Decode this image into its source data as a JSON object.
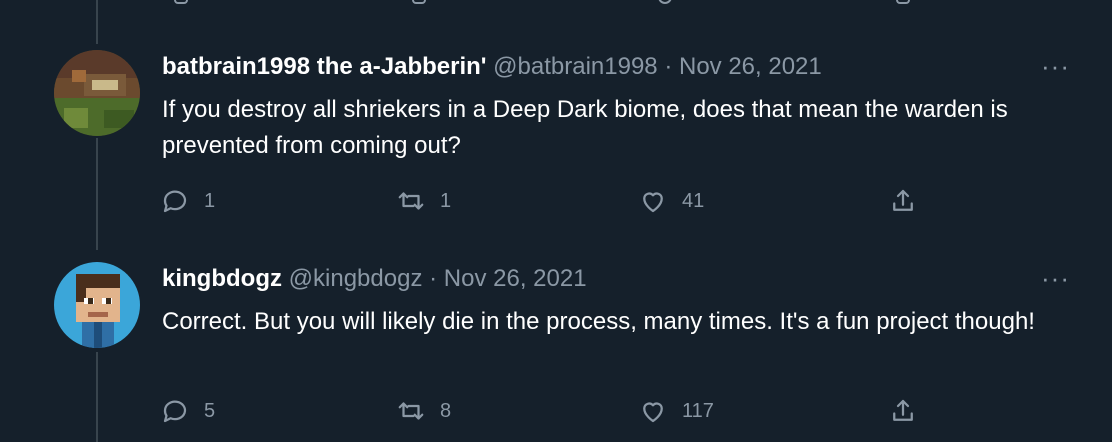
{
  "tweets": [
    {
      "display_name": "batbrain1998 the a-Jabberin'",
      "handle": "@batbrain1998",
      "separator": "·",
      "date": "Nov 26, 2021",
      "text": "If you destroy all shriekers in a Deep Dark biome, does that mean the warden is prevented from coming out?",
      "replies": "1",
      "retweets": "1",
      "likes": "41",
      "avatar_icon": "minecraft-scene-avatar"
    },
    {
      "display_name": "kingbdogz",
      "handle": "@kingbdogz",
      "separator": "·",
      "date": "Nov 26, 2021",
      "text": "Correct. But you will likely die in the process, many times. It's a fun project though!",
      "replies": "5",
      "retweets": "8",
      "likes": "117",
      "avatar_icon": "pixel-character-avatar"
    }
  ],
  "more_label": "···",
  "colors": {
    "background": "#15202b",
    "secondary_text": "#8b98a5",
    "thread_line": "#38444d",
    "kingbdogz_avatar_bg": "#3ba6d9"
  }
}
